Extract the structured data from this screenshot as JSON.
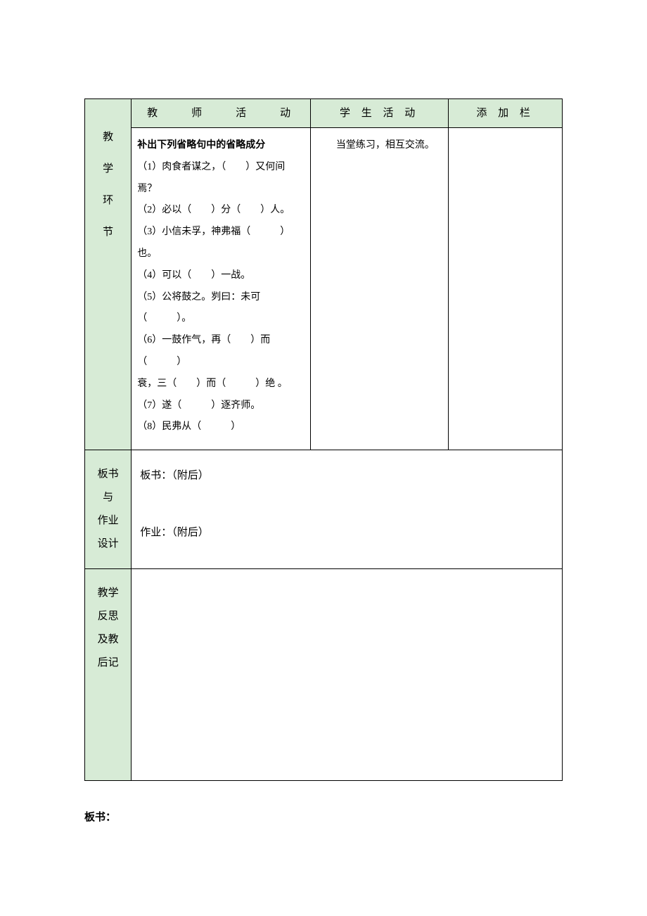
{
  "header": {
    "teacher": "教　　师　　活　　动",
    "student": "学 生 活 动",
    "addon": "添 加 栏"
  },
  "sidebar": {
    "ch0": "教",
    "ch1": "学",
    "ch2": "环",
    "ch3": "节"
  },
  "teacher": {
    "title": "补出下列省略句中的省略成分",
    "l1": "（1）肉食者谋之，（　　）又何间焉？",
    "l2": "（2）必以（　　）分（　　）人。",
    "l3": "（3）小信未孚，神弗福（　　　）也。",
    "l4": "（4）可以（　　）一战。",
    "l5": "（5）公将鼓之。刿曰：未可（　　　）。",
    "l6a": "（6）一鼓作气，再（　　）而（　　　）",
    "l6b": "衰，三（　　）而（　　　）绝 。",
    "l7": "（7）遂（　　　）逐齐师。",
    "l8": "（8）民弗从（　　　）"
  },
  "student": {
    "text": "　　当堂练习，相互交流。"
  },
  "board": {
    "label_l1": "板书",
    "label_l2": "与",
    "label_l3": "作业",
    "label_l4": "设计",
    "body_l1": "板书：（附后）",
    "body_l2": "作业：（附后）"
  },
  "reflect": {
    "label_l1": "教学",
    "label_l2": "反思",
    "label_l3": "及教",
    "label_l4": "后记"
  },
  "footer": {
    "label": "板书："
  }
}
